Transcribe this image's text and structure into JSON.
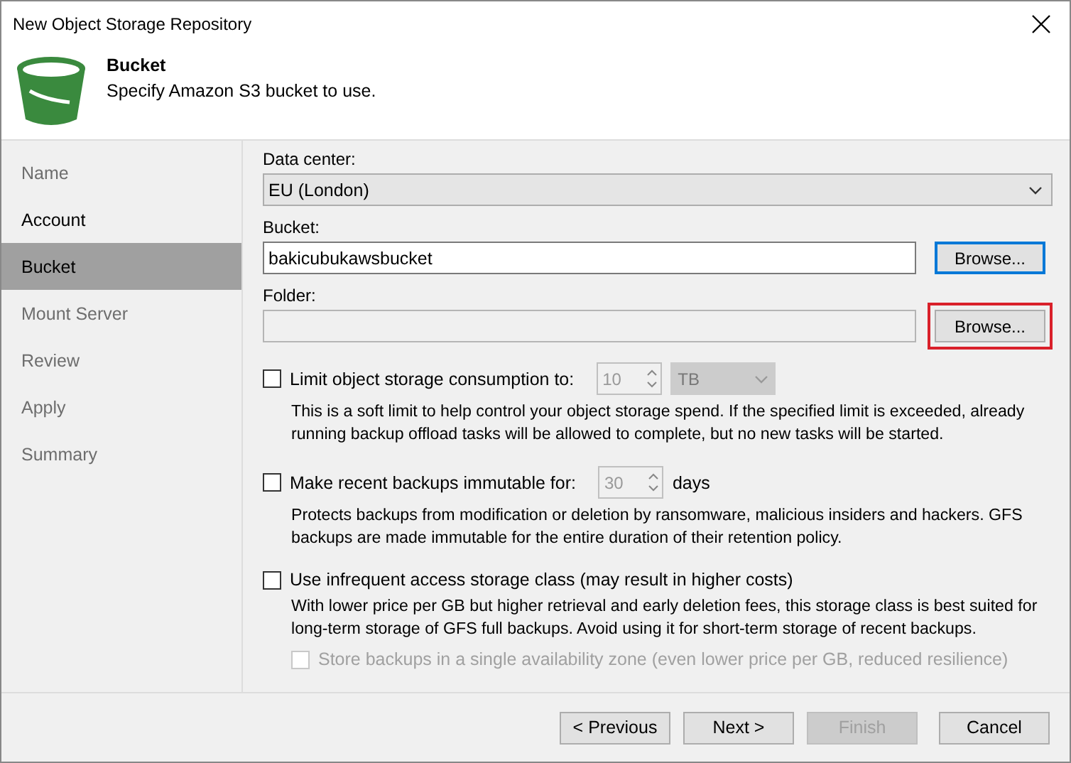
{
  "window": {
    "title": "New Object Storage Repository"
  },
  "header": {
    "title": "Bucket",
    "subtitle": "Specify Amazon S3 bucket to use."
  },
  "sidebar": {
    "items": [
      {
        "label": "Name",
        "selected": false,
        "disabled": true
      },
      {
        "label": "Account",
        "selected": false,
        "disabled": false
      },
      {
        "label": "Bucket",
        "selected": true,
        "disabled": false
      },
      {
        "label": "Mount Server",
        "selected": false,
        "disabled": true
      },
      {
        "label": "Review",
        "selected": false,
        "disabled": true
      },
      {
        "label": "Apply",
        "selected": false,
        "disabled": true
      },
      {
        "label": "Summary",
        "selected": false,
        "disabled": true
      }
    ]
  },
  "data_center": {
    "label": "Data center:",
    "value": "EU (London)"
  },
  "bucket": {
    "label": "Bucket:",
    "value": "bakicubukawsbucket",
    "browse": {
      "label": "Browse...",
      "focused": true,
      "highlighted": false
    }
  },
  "folder": {
    "label": "Folder:",
    "browse": {
      "label": "Browse...",
      "focused": false,
      "highlighted": true
    }
  },
  "options": [
    {
      "kind": "spin-unit",
      "label": "Limit object storage consumption to:",
      "checked": false,
      "disabled": false,
      "spin": "10",
      "unit": "TB",
      "description": "This is a soft limit to help control your object storage spend. If the specified limit is exceeded, already running backup offload tasks will be allowed to complete, but no new tasks will be started."
    },
    {
      "kind": "spin-suffix",
      "label": "Make recent backups immutable for:",
      "checked": false,
      "disabled": false,
      "spin": "30",
      "suffix": "days",
      "description": "Protects backups from modification or deletion by ransomware, malicious insiders and hackers. GFS backups are made immutable for the entire duration of their retention policy."
    },
    {
      "kind": "plain",
      "label": "Use infrequent access storage class (may result in higher costs)",
      "checked": false,
      "disabled": false,
      "description": "With lower price per GB but higher retrieval and early deletion fees, this storage class is best suited for long-term storage of GFS full backups. Avoid using it for short-term storage of recent backups.",
      "sub": {
        "label": "Store backups in a single availability zone (even lower price per GB, reduced resilience)",
        "checked": false,
        "disabled": true
      }
    }
  ],
  "buttons": [
    {
      "label": "< Previous",
      "disabled": false
    },
    {
      "label": "Next >",
      "disabled": false
    },
    {
      "label": "Finish",
      "disabled": true
    },
    {
      "label": "Cancel",
      "disabled": false
    }
  ]
}
